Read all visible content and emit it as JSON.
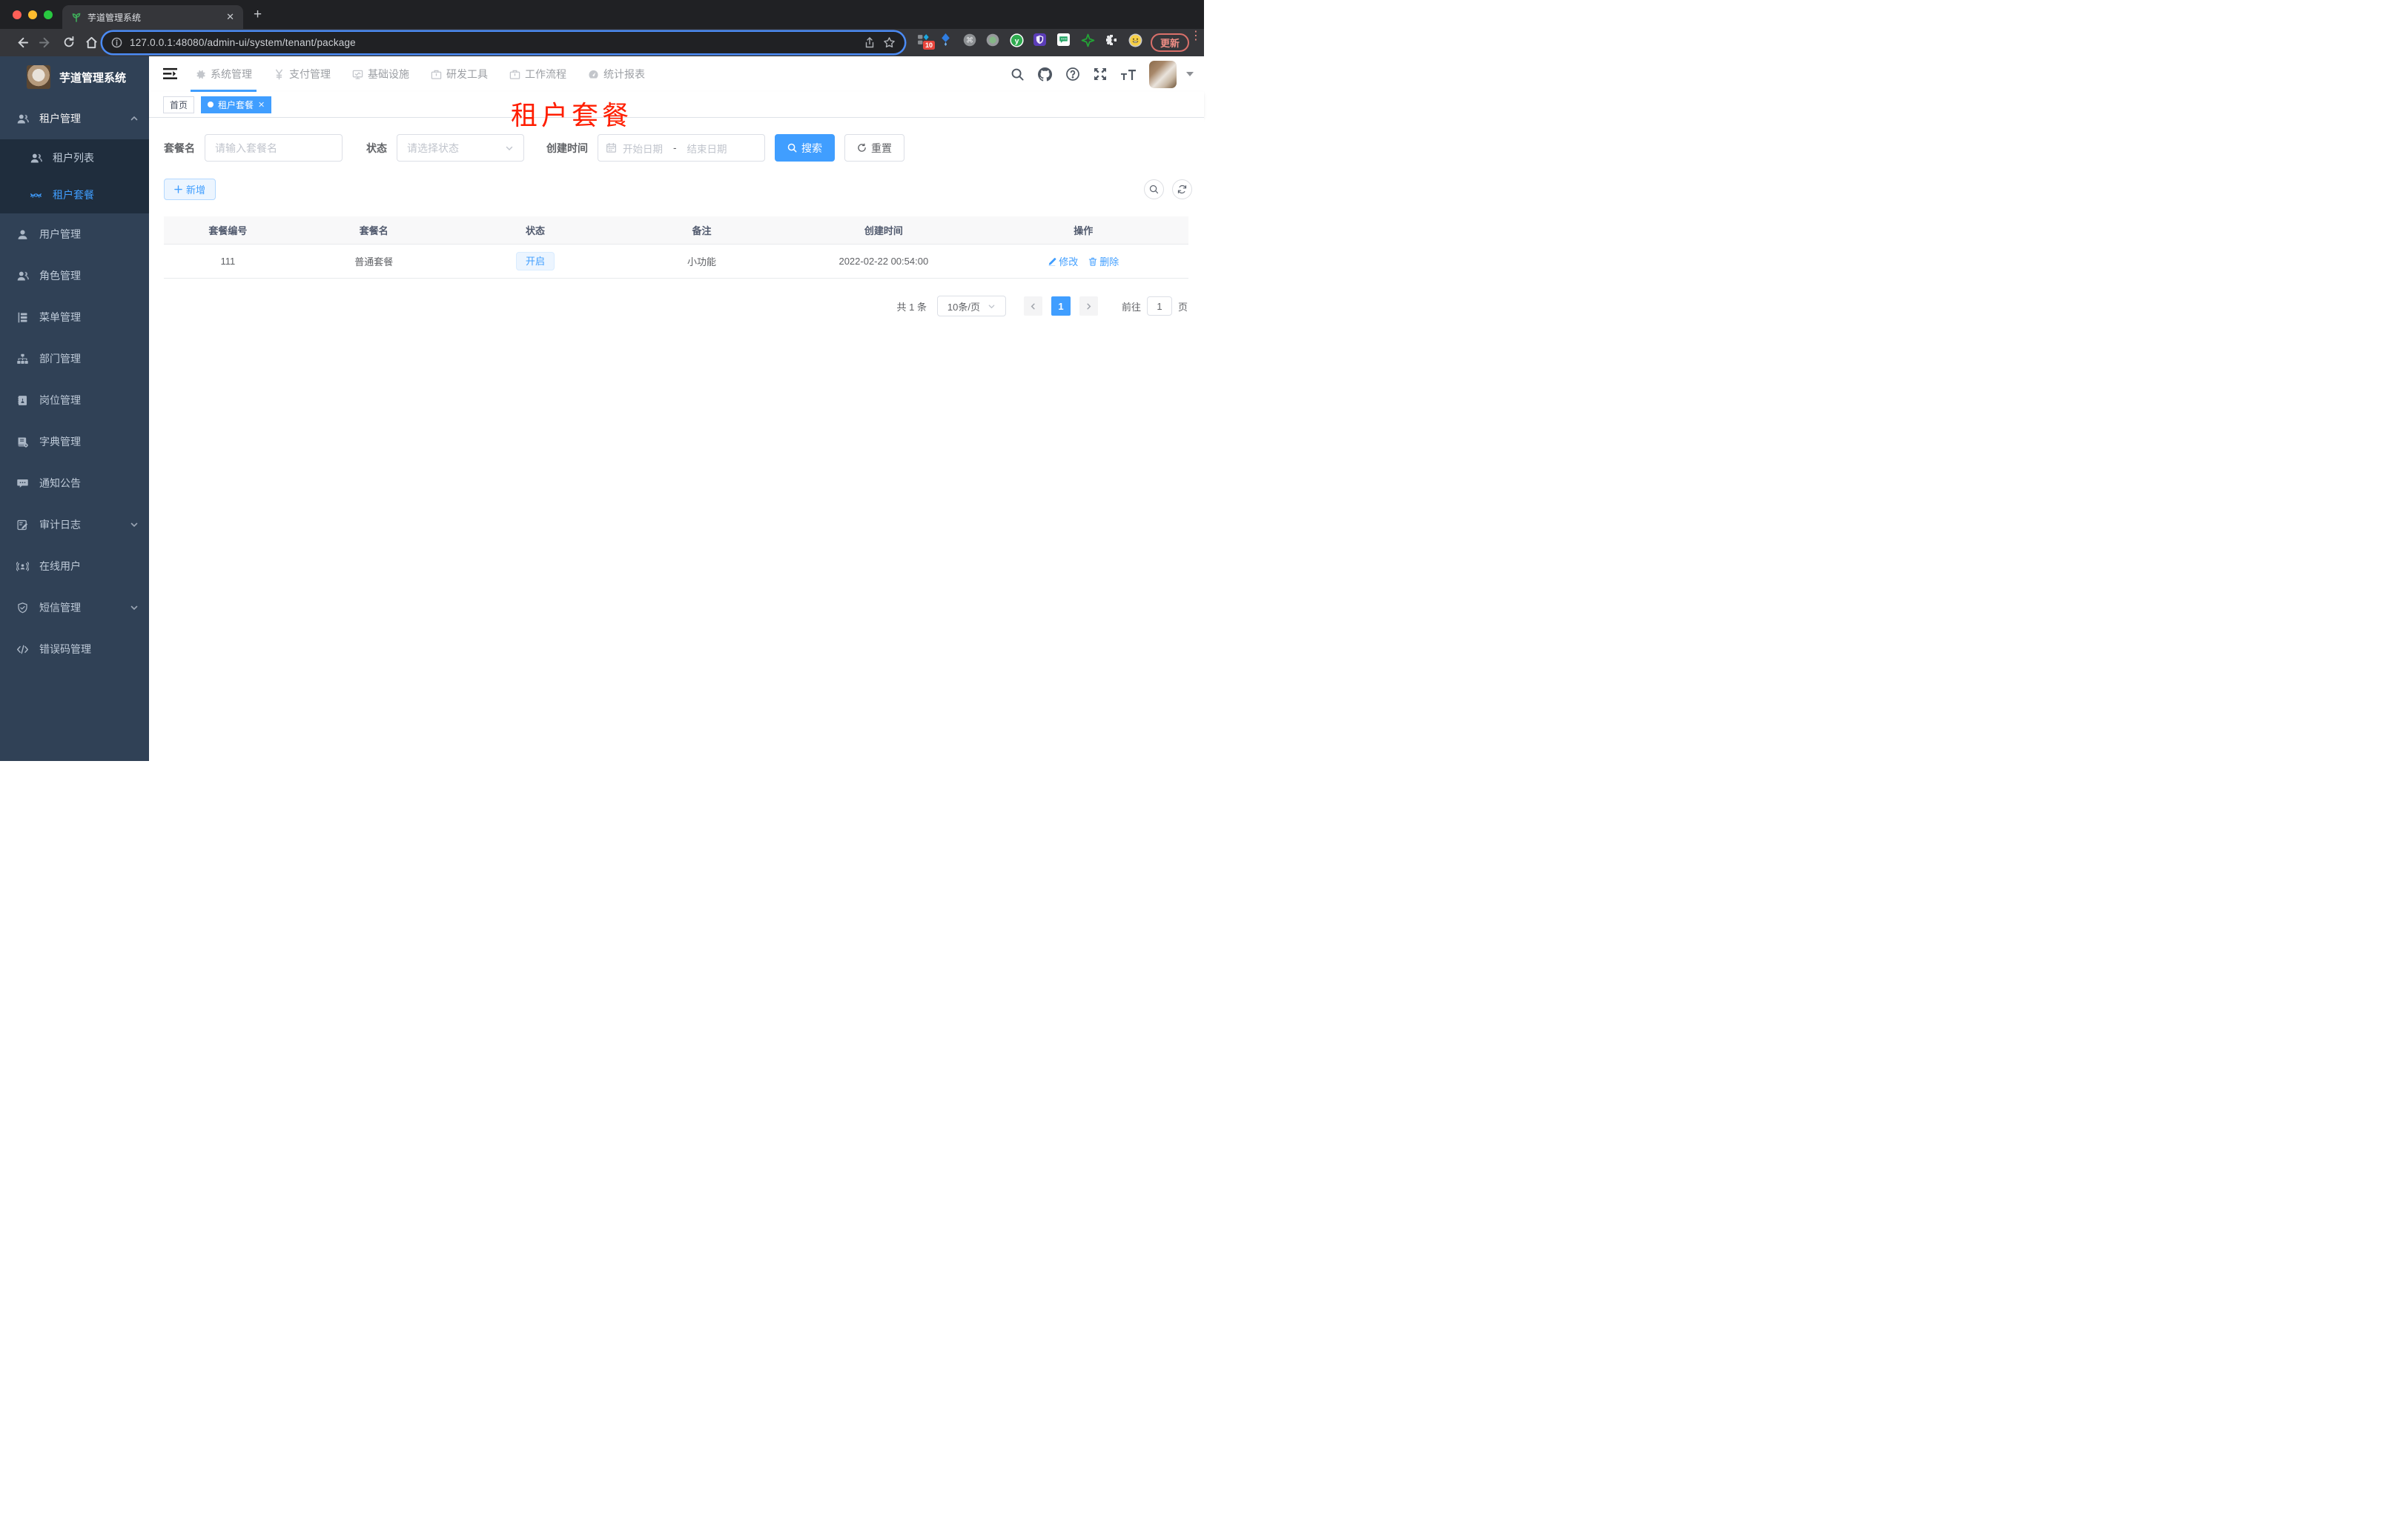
{
  "colors": {
    "primary": "#409eff",
    "sidebar_bg": "#304156",
    "sidebar_submenu_bg": "#1f2d3d",
    "debug_title_red": "#ff1e00",
    "status_tag_bg": "#ecf5ff",
    "tag_active_bg": "#409eff"
  },
  "browser": {
    "tab_title": "芋道管理系统",
    "url": "127.0.0.1:48080/admin-ui/system/tenant/package",
    "extension_badge": "10",
    "update_label": "更新"
  },
  "topnav": {
    "items": [
      "系统管理",
      "支付管理",
      "基础设施",
      "研发工具",
      "工作流程",
      "统计报表"
    ]
  },
  "sidebar": {
    "title": "芋道管理系统",
    "group_tenant": "租户管理",
    "sub_tenant_list": "租户列表",
    "sub_tenant_package": "租户套餐",
    "item_user": "用户管理",
    "item_role": "角色管理",
    "item_menu": "菜单管理",
    "item_dept": "部门管理",
    "item_post": "岗位管理",
    "item_dict": "字典管理",
    "item_notice": "通知公告",
    "item_audit": "审计日志",
    "item_online": "在线用户",
    "item_sms": "短信管理",
    "item_errcode": "错误码管理"
  },
  "tags": {
    "home": "首页",
    "current": "租户套餐"
  },
  "page": {
    "debug_title": "租户套餐",
    "filters": {
      "name_label": "套餐名",
      "name_placeholder": "请输入套餐名",
      "status_label": "状态",
      "status_placeholder": "请选择状态",
      "date_label": "创建时间",
      "date_start": "开始日期",
      "date_sep": "-",
      "date_end": "结束日期",
      "search_label": "搜索",
      "reset_label": "重置"
    },
    "toolbar": {
      "add_label": "新增"
    },
    "table": {
      "headers": [
        "套餐编号",
        "套餐名",
        "状态",
        "备注",
        "创建时间",
        "操作"
      ],
      "rows": [
        {
          "id": "111",
          "name": "普通套餐",
          "status": "开启",
          "remark": "小功能",
          "created": "2022-02-22 00:54:00",
          "edit_label": "修改",
          "delete_label": "删除"
        }
      ]
    },
    "pagination": {
      "total": "共 1 条",
      "page_size": "10条/页",
      "current_page": "1",
      "goto_label": "前往",
      "goto_value": "1",
      "unit_label": "页"
    }
  }
}
